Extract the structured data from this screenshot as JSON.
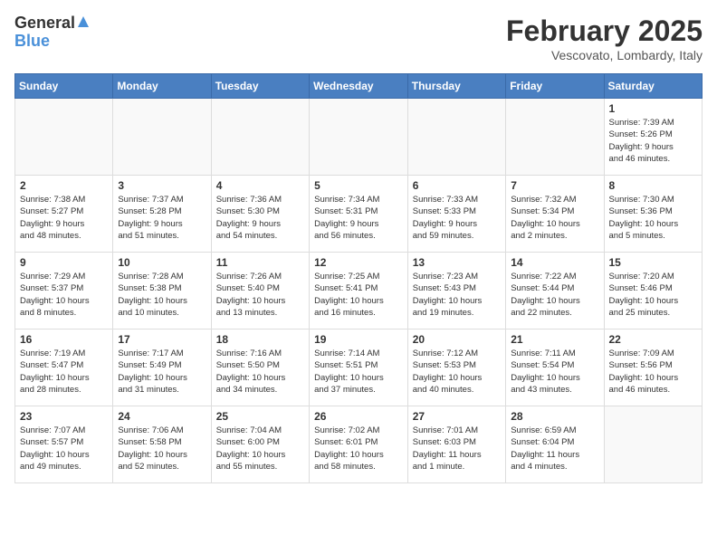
{
  "logo": {
    "general": "General",
    "blue": "Blue"
  },
  "title": {
    "month_year": "February 2025",
    "location": "Vescovato, Lombardy, Italy"
  },
  "headers": [
    "Sunday",
    "Monday",
    "Tuesday",
    "Wednesday",
    "Thursday",
    "Friday",
    "Saturday"
  ],
  "weeks": [
    [
      {
        "day": "",
        "info": ""
      },
      {
        "day": "",
        "info": ""
      },
      {
        "day": "",
        "info": ""
      },
      {
        "day": "",
        "info": ""
      },
      {
        "day": "",
        "info": ""
      },
      {
        "day": "",
        "info": ""
      },
      {
        "day": "1",
        "info": "Sunrise: 7:39 AM\nSunset: 5:26 PM\nDaylight: 9 hours\nand 46 minutes."
      }
    ],
    [
      {
        "day": "2",
        "info": "Sunrise: 7:38 AM\nSunset: 5:27 PM\nDaylight: 9 hours\nand 48 minutes."
      },
      {
        "day": "3",
        "info": "Sunrise: 7:37 AM\nSunset: 5:28 PM\nDaylight: 9 hours\nand 51 minutes."
      },
      {
        "day": "4",
        "info": "Sunrise: 7:36 AM\nSunset: 5:30 PM\nDaylight: 9 hours\nand 54 minutes."
      },
      {
        "day": "5",
        "info": "Sunrise: 7:34 AM\nSunset: 5:31 PM\nDaylight: 9 hours\nand 56 minutes."
      },
      {
        "day": "6",
        "info": "Sunrise: 7:33 AM\nSunset: 5:33 PM\nDaylight: 9 hours\nand 59 minutes."
      },
      {
        "day": "7",
        "info": "Sunrise: 7:32 AM\nSunset: 5:34 PM\nDaylight: 10 hours\nand 2 minutes."
      },
      {
        "day": "8",
        "info": "Sunrise: 7:30 AM\nSunset: 5:36 PM\nDaylight: 10 hours\nand 5 minutes."
      }
    ],
    [
      {
        "day": "9",
        "info": "Sunrise: 7:29 AM\nSunset: 5:37 PM\nDaylight: 10 hours\nand 8 minutes."
      },
      {
        "day": "10",
        "info": "Sunrise: 7:28 AM\nSunset: 5:38 PM\nDaylight: 10 hours\nand 10 minutes."
      },
      {
        "day": "11",
        "info": "Sunrise: 7:26 AM\nSunset: 5:40 PM\nDaylight: 10 hours\nand 13 minutes."
      },
      {
        "day": "12",
        "info": "Sunrise: 7:25 AM\nSunset: 5:41 PM\nDaylight: 10 hours\nand 16 minutes."
      },
      {
        "day": "13",
        "info": "Sunrise: 7:23 AM\nSunset: 5:43 PM\nDaylight: 10 hours\nand 19 minutes."
      },
      {
        "day": "14",
        "info": "Sunrise: 7:22 AM\nSunset: 5:44 PM\nDaylight: 10 hours\nand 22 minutes."
      },
      {
        "day": "15",
        "info": "Sunrise: 7:20 AM\nSunset: 5:46 PM\nDaylight: 10 hours\nand 25 minutes."
      }
    ],
    [
      {
        "day": "16",
        "info": "Sunrise: 7:19 AM\nSunset: 5:47 PM\nDaylight: 10 hours\nand 28 minutes."
      },
      {
        "day": "17",
        "info": "Sunrise: 7:17 AM\nSunset: 5:49 PM\nDaylight: 10 hours\nand 31 minutes."
      },
      {
        "day": "18",
        "info": "Sunrise: 7:16 AM\nSunset: 5:50 PM\nDaylight: 10 hours\nand 34 minutes."
      },
      {
        "day": "19",
        "info": "Sunrise: 7:14 AM\nSunset: 5:51 PM\nDaylight: 10 hours\nand 37 minutes."
      },
      {
        "day": "20",
        "info": "Sunrise: 7:12 AM\nSunset: 5:53 PM\nDaylight: 10 hours\nand 40 minutes."
      },
      {
        "day": "21",
        "info": "Sunrise: 7:11 AM\nSunset: 5:54 PM\nDaylight: 10 hours\nand 43 minutes."
      },
      {
        "day": "22",
        "info": "Sunrise: 7:09 AM\nSunset: 5:56 PM\nDaylight: 10 hours\nand 46 minutes."
      }
    ],
    [
      {
        "day": "23",
        "info": "Sunrise: 7:07 AM\nSunset: 5:57 PM\nDaylight: 10 hours\nand 49 minutes."
      },
      {
        "day": "24",
        "info": "Sunrise: 7:06 AM\nSunset: 5:58 PM\nDaylight: 10 hours\nand 52 minutes."
      },
      {
        "day": "25",
        "info": "Sunrise: 7:04 AM\nSunset: 6:00 PM\nDaylight: 10 hours\nand 55 minutes."
      },
      {
        "day": "26",
        "info": "Sunrise: 7:02 AM\nSunset: 6:01 PM\nDaylight: 10 hours\nand 58 minutes."
      },
      {
        "day": "27",
        "info": "Sunrise: 7:01 AM\nSunset: 6:03 PM\nDaylight: 11 hours\nand 1 minute."
      },
      {
        "day": "28",
        "info": "Sunrise: 6:59 AM\nSunset: 6:04 PM\nDaylight: 11 hours\nand 4 minutes."
      },
      {
        "day": "",
        "info": ""
      }
    ]
  ]
}
